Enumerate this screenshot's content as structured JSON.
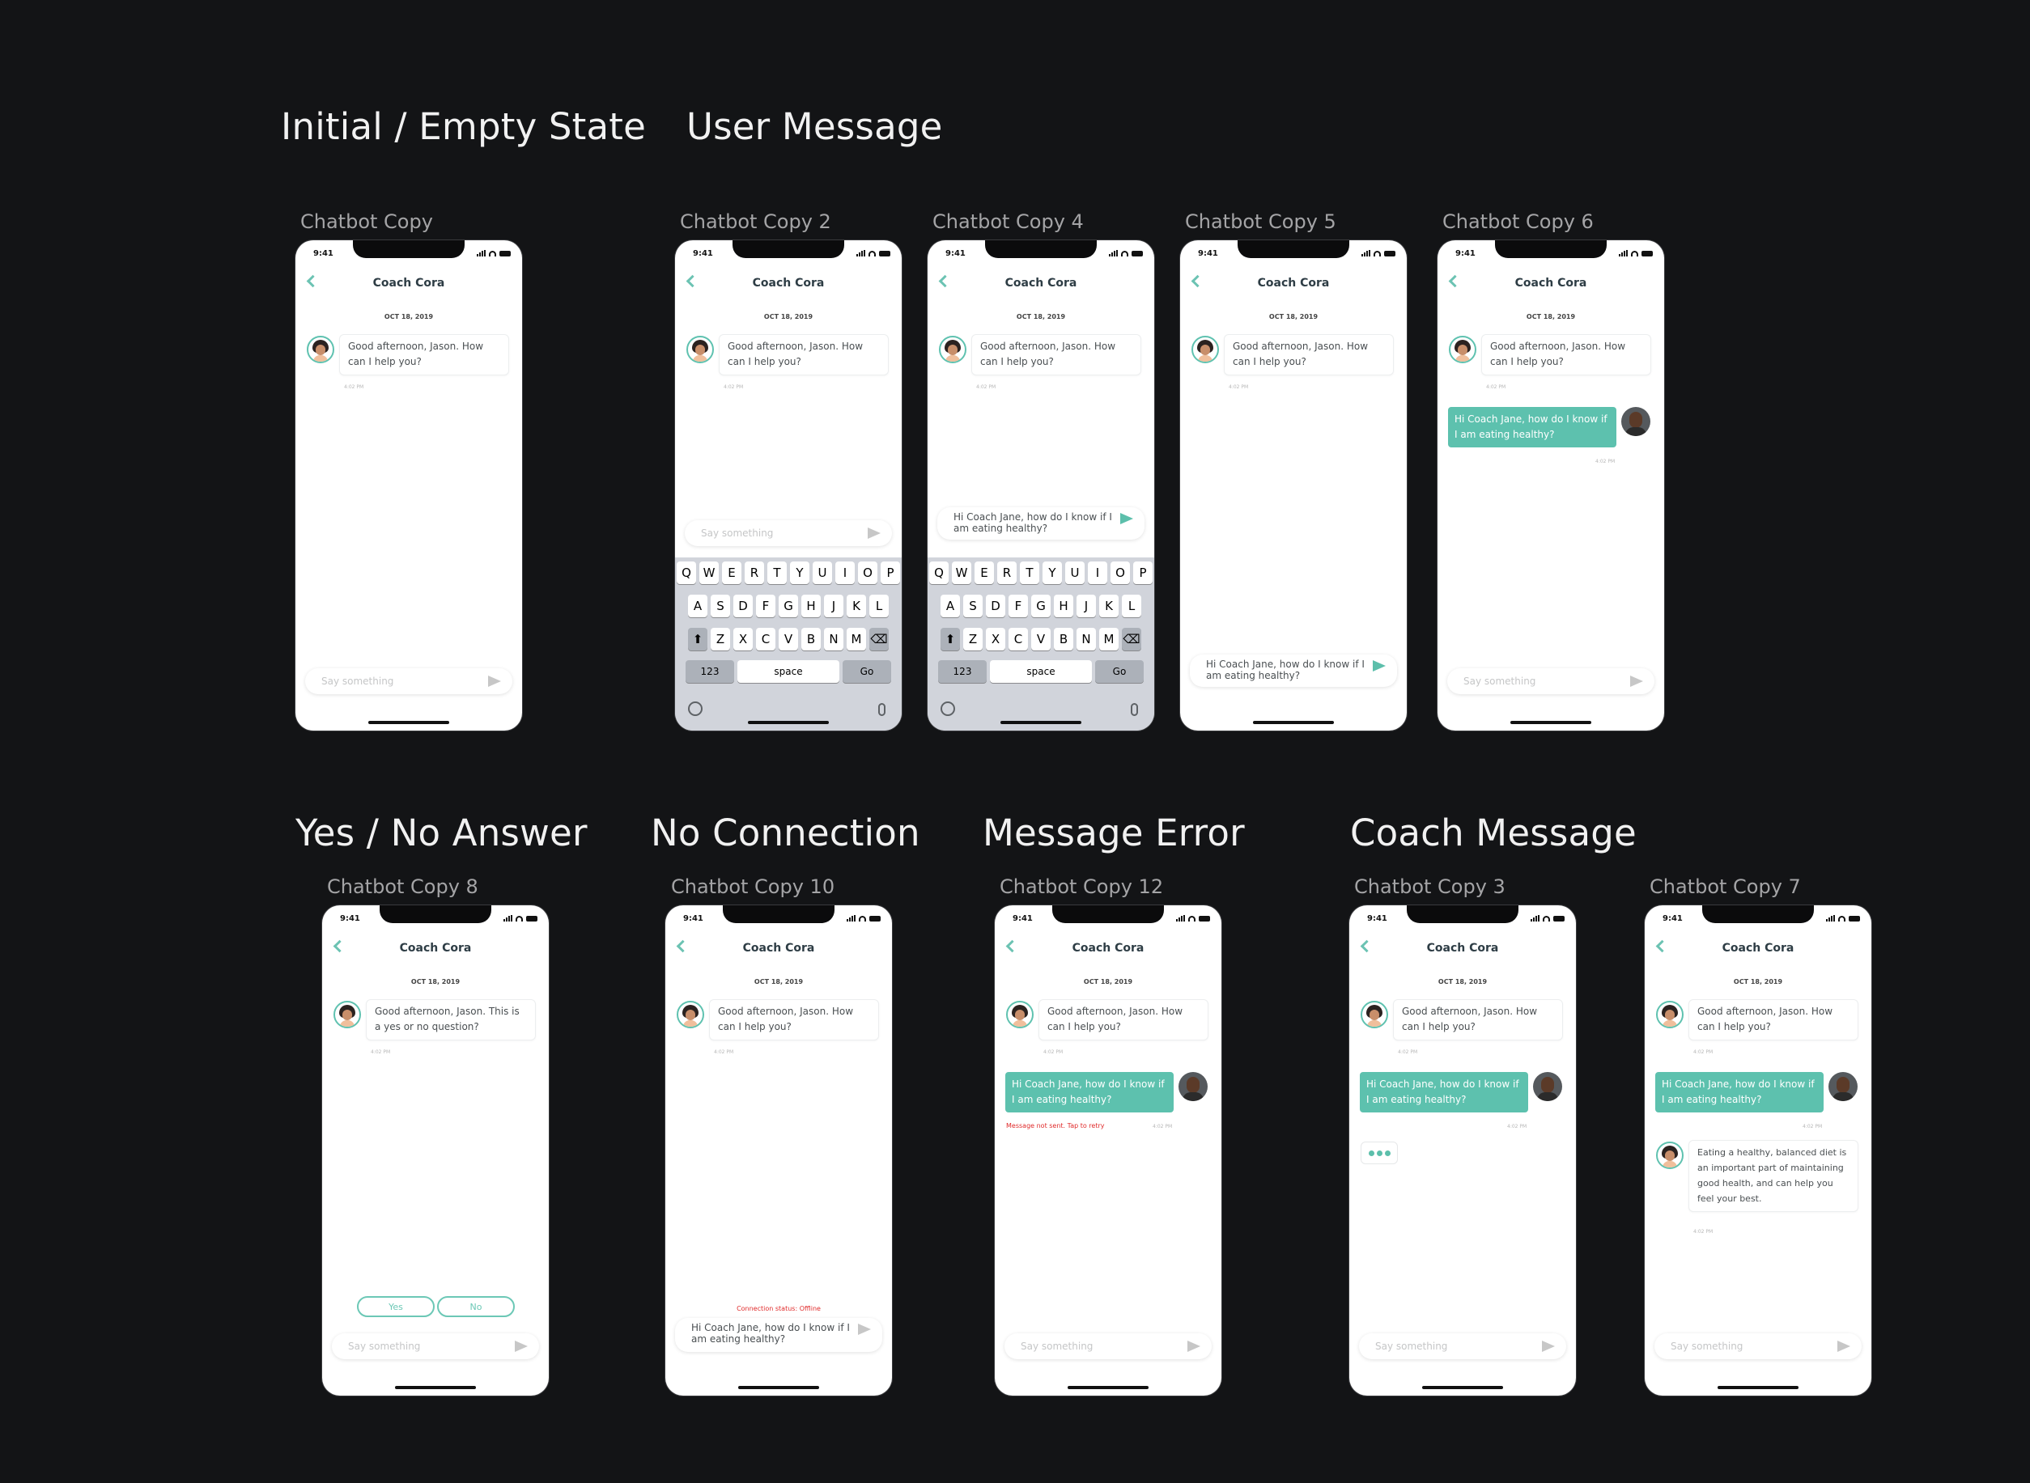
{
  "sections": {
    "initial": "Initial / Empty State",
    "user_message": "User Message",
    "yes_no": "Yes / No Answer",
    "no_connection": "No Connection",
    "message_error": "Message Error",
    "coach_message": "Coach Message"
  },
  "frames": {
    "copy": "Chatbot Copy",
    "copy2": "Chatbot Copy 2",
    "copy4": "Chatbot Copy 4",
    "copy5": "Chatbot Copy 5",
    "copy6": "Chatbot Copy 6",
    "copy8": "Chatbot Copy 8",
    "copy10": "Chatbot Copy 10",
    "copy12": "Chatbot Copy 12",
    "copy3": "Chatbot Copy 3",
    "copy7": "Chatbot Copy 7"
  },
  "chat": {
    "status_time": "9:41",
    "title": "Coach Cora",
    "date": "OCT 18, 2019",
    "greeting": "Good afternoon, Jason. How can I help you?",
    "yes_no_question": "Good afternoon, Jason. This is a yes or no question?",
    "user_message": "Hi Coach Jane, how do I know if I am eating healthy?",
    "coach_reply": "Eating a healthy, balanced diet  is an important part of maintaining good health, and can help you feel your best.",
    "timestamp": "4:02 PM",
    "placeholder": "Say something",
    "yes": "Yes",
    "no": "No",
    "offline": "Connection status: Offline",
    "error": "Message not sent. Tap to retry"
  },
  "keyboard": {
    "row1": [
      "Q",
      "W",
      "E",
      "R",
      "T",
      "Y",
      "U",
      "I",
      "O",
      "P"
    ],
    "row2": [
      "A",
      "S",
      "D",
      "F",
      "G",
      "H",
      "J",
      "K",
      "L"
    ],
    "row3": [
      "Z",
      "X",
      "C",
      "V",
      "B",
      "N",
      "M"
    ],
    "num": "123",
    "space": "space",
    "go": "Go"
  },
  "colors": {
    "accent": "#5dc1ae",
    "background": "#131416",
    "error": "#e02a2a"
  }
}
